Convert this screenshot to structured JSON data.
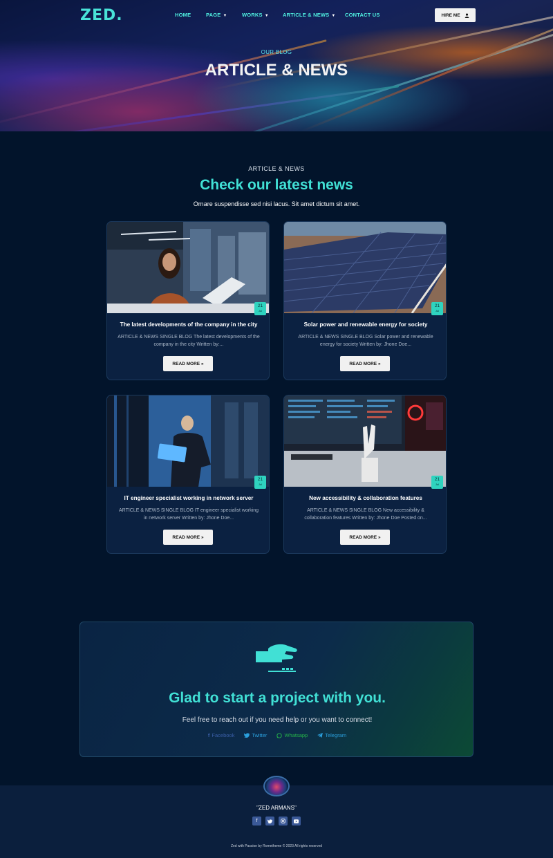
{
  "colors": {
    "accent": "#41e0d5",
    "background": "#02142b",
    "card": "#0b2141",
    "badge": "#2fd3bf"
  },
  "brand": {
    "logo": "ZED."
  },
  "nav": {
    "items": [
      {
        "label": "HOME",
        "has_dropdown": false
      },
      {
        "label": "PAGE",
        "has_dropdown": true
      },
      {
        "label": "WORKS",
        "has_dropdown": true
      },
      {
        "label": "ARTICLE & NEWS",
        "has_dropdown": true
      },
      {
        "label": "CONTACT US",
        "has_dropdown": false
      }
    ],
    "hire_label": "HIRE ME",
    "hire_icon": "user-icon"
  },
  "hero": {
    "subtitle": "OUR BLOG",
    "title": "ARTICLE & NEWS"
  },
  "section": {
    "kicker": "ARTICLE & NEWS",
    "title": "Check our latest news",
    "description": "Ornare suspendisse sed nisi lacus. Sit amet dictum sit amet."
  },
  "posts": [
    {
      "title": "The latest developments of the company in the city",
      "excerpt": "ARTICLE & NEWS SINGLE BLOG The latest developments of the company in the city Written by:...",
      "day": "21",
      "month": "Jul",
      "read_more": "READ MORE »"
    },
    {
      "title": "Solar power and renewable energy for society",
      "excerpt": "ARTICLE & NEWS SINGLE BLOG Solar power and renewable energy for society Written by: Jhone Doe...",
      "day": "21",
      "month": "Jul",
      "read_more": "READ MORE »"
    },
    {
      "title": "IT engineer specialist working in network server",
      "excerpt": "ARTICLE & NEWS SINGLE BLOG IT engineer specialist working in network server Written by: Jhone Doe...",
      "day": "21",
      "month": "Jul",
      "read_more": "READ MORE »"
    },
    {
      "title": "New accessibility & collaboration features",
      "excerpt": "ARTICLE & NEWS SINGLE BLOG New accessibility & collaboration features Written by: Jhone Doe Posted on...",
      "day": "21",
      "month": "Jul",
      "read_more": "READ MORE »"
    }
  ],
  "cta": {
    "title": "Glad to start a project with you.",
    "description": "Feel free to reach out if you need help or you want to connect!",
    "socials": [
      {
        "label": "Facebook",
        "icon": "facebook-icon",
        "color": "#3b5fa8"
      },
      {
        "label": "Twitter",
        "icon": "twitter-icon",
        "color": "#2b9fdc"
      },
      {
        "label": "Whatsapp",
        "icon": "whatsapp-icon",
        "color": "#25b34a"
      },
      {
        "label": "Telegram",
        "icon": "telegram-icon",
        "color": "#2b9fdc"
      }
    ]
  },
  "footer": {
    "name": "\"ZED ARMANS\"",
    "icons": [
      "facebook-icon",
      "twitter-icon",
      "instagram-icon",
      "youtube-icon"
    ],
    "copyright": "Zed with Passion by Rometheme © 2023 All rights reserved"
  }
}
